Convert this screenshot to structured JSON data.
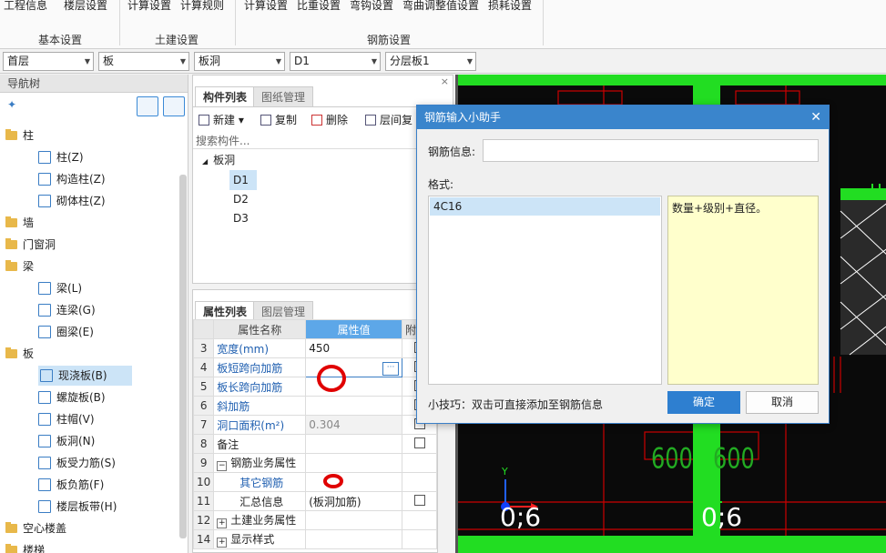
{
  "ribbon": {
    "items": [
      "工程信息",
      "楼层设置",
      "计算设置",
      "计算规则",
      "计算设置",
      "比重设置",
      "弯钩设置",
      "弯曲调整值设置",
      "损耗设置"
    ],
    "groups": [
      "基本设置",
      "土建设置",
      "钢筋设置"
    ]
  },
  "selectors": [
    "首层",
    "板",
    "板洞",
    "D1",
    "分层板1"
  ],
  "nav": {
    "title": "导航树",
    "items": [
      {
        "label": "柱",
        "type": "folder"
      },
      {
        "label": "柱(Z)",
        "type": "leaf"
      },
      {
        "label": "构造柱(Z)",
        "type": "leaf"
      },
      {
        "label": "砌体柱(Z)",
        "type": "leaf"
      },
      {
        "label": "墙",
        "type": "folder"
      },
      {
        "label": "门窗洞",
        "type": "folder"
      },
      {
        "label": "梁",
        "type": "folder"
      },
      {
        "label": "梁(L)",
        "type": "leaf"
      },
      {
        "label": "连梁(G)",
        "type": "leaf"
      },
      {
        "label": "圈梁(E)",
        "type": "leaf"
      },
      {
        "label": "板",
        "type": "folder"
      },
      {
        "label": "现浇板(B)",
        "type": "leaf",
        "selected": true
      },
      {
        "label": "螺旋板(B)",
        "type": "leaf"
      },
      {
        "label": "柱帽(V)",
        "type": "leaf"
      },
      {
        "label": "板洞(N)",
        "type": "leaf"
      },
      {
        "label": "板受力筋(S)",
        "type": "leaf"
      },
      {
        "label": "板负筋(F)",
        "type": "leaf"
      },
      {
        "label": "楼层板带(H)",
        "type": "leaf"
      },
      {
        "label": "空心楼盖",
        "type": "folder"
      },
      {
        "label": "楼梯",
        "type": "folder"
      }
    ]
  },
  "component_list": {
    "tabs": [
      "构件列表",
      "图纸管理"
    ],
    "toolbar": {
      "new": "新建",
      "copy": "复制",
      "delete": "删除",
      "floor_copy": "层间复"
    },
    "search_placeholder": "搜索构件...",
    "tree_root": "板洞",
    "tree_items": [
      "D1",
      "D2",
      "D3"
    ]
  },
  "properties": {
    "tabs": [
      "属性列表",
      "图层管理"
    ],
    "headers": {
      "name": "属性名称",
      "value": "属性值",
      "attach": "附"
    },
    "rows": [
      {
        "num": "3",
        "name": "宽度(mm)",
        "value": "450",
        "check": true
      },
      {
        "num": "4",
        "name": "板短跨向加筋",
        "value": "",
        "check": true
      },
      {
        "num": "5",
        "name": "板长跨向加筋",
        "value": "",
        "check": true
      },
      {
        "num": "6",
        "name": "斜加筋",
        "value": "",
        "check": true
      },
      {
        "num": "7",
        "name": "洞口面积(m²)",
        "value": "0.304",
        "check": true
      },
      {
        "num": "8",
        "name": "备注",
        "value": "",
        "check": true
      },
      {
        "num": "9",
        "name": "钢筋业务属性",
        "value": "",
        "check": false,
        "expand": "−"
      },
      {
        "num": "10",
        "name": "其它钢筋",
        "value": "",
        "check": false
      },
      {
        "num": "11",
        "name": "汇总信息",
        "value": "(板洞加筋)",
        "check": true
      },
      {
        "num": "12",
        "name": "土建业务属性",
        "value": "",
        "check": false,
        "expand": "+"
      },
      {
        "num": "14",
        "name": "显示样式",
        "value": "",
        "check": false,
        "expand": "+"
      }
    ]
  },
  "canvas": {
    "labels": [
      "600",
      "600",
      "0;6",
      "0;6"
    ],
    "axis_y": "Y"
  },
  "dialog": {
    "title": "钢筋输入小助手",
    "info_label": "钢筋信息:",
    "info_value": "",
    "format_label": "格式:",
    "format_items": [
      "4C16"
    ],
    "description": "数量+级别+直径。",
    "tip": "小技巧：双击可直接添加至钢筋信息",
    "ok": "确定",
    "cancel": "取消"
  },
  "colors": {
    "accent": "#3a85cc",
    "green": "#22dd22",
    "red": "#cc0000"
  }
}
